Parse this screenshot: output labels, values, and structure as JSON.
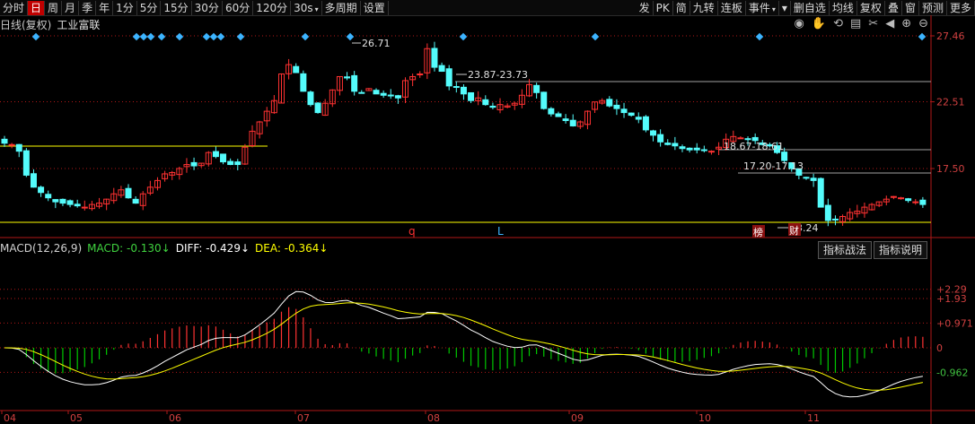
{
  "toolbar": {
    "left": [
      "分时",
      "日",
      "周",
      "月",
      "季",
      "年",
      "1分",
      "5分",
      "15分",
      "30分",
      "60分",
      "120分",
      "30s",
      "多周期",
      "设置"
    ],
    "active": "日",
    "right": [
      "发",
      "PK",
      "简",
      "九转",
      "连板",
      "事件",
      "▾",
      "删自选",
      "均线",
      "复权",
      "叠",
      "窗",
      "预测",
      "更多"
    ]
  },
  "header": {
    "name_prefix": "日线(复权)",
    "stock_name": "工业富联"
  },
  "header_icons": [
    "eye-icon",
    "hand-icon",
    "history-icon",
    "tools-icon",
    "scissors-icon",
    "arrow-left-icon",
    "plus-icon",
    "minus-icon"
  ],
  "colors": {
    "up": "#ff3232",
    "down": "#54fcfc",
    "dif": "#ffffff",
    "dea": "#ffff00",
    "axis": "#b01818",
    "hline": "#ffff00"
  },
  "price_axis": {
    "labels": [
      "27.46",
      "22.51",
      "17.50"
    ]
  },
  "macd": {
    "title": "MACD(12,26,9)",
    "macd_label": "MACD:",
    "macd_value": "-0.130",
    "diff_label": "DIFF:",
    "diff_value": "-0.429",
    "dea_label": "DEA:",
    "dea_value": "-0.364",
    "axis_labels": [
      "2.29",
      "1.93",
      "0.971",
      "0",
      "-0.962"
    ]
  },
  "buttons": {
    "strategy": "指标战法",
    "explain": "指标说明"
  },
  "x_axis": [
    "04",
    "05",
    "06",
    "07",
    "08",
    "09",
    "10",
    "11"
  ],
  "annotations": {
    "high": "26.71",
    "range1": "23.87-23.73",
    "range2": "18.67-18.61",
    "range3": "17.20-17.13",
    "low": "13.24",
    "mark_q": "q",
    "mark_l": "L",
    "badge_bang": "榜",
    "badge_cai": "财"
  },
  "chart_data": {
    "type": "candlestick",
    "period": "daily",
    "y_ticks": [
      27.46,
      22.51,
      17.5
    ],
    "candles_count": 126,
    "close_approx": [
      19.4,
      19.3,
      18.8,
      17.0,
      16.1,
      15.7,
      15.3,
      15.0,
      14.9,
      14.8,
      14.7,
      14.6,
      14.8,
      14.9,
      15.2,
      15.6,
      15.9,
      15.3,
      14.9,
      15.6,
      16.1,
      16.6,
      17.1,
      17.2,
      17.5,
      17.8,
      17.7,
      17.9,
      18.7,
      18.4,
      18.0,
      17.8,
      17.8,
      19.1,
      20.3,
      21.0,
      21.8,
      22.6,
      24.6,
      25.3,
      24.7,
      23.3,
      22.3,
      21.7,
      22.4,
      23.4,
      24.4,
      24.3,
      23.3,
      23.2,
      23.5,
      23.1,
      23.0,
      23.0,
      22.8,
      24.1,
      24.4,
      24.6,
      26.5,
      25.1,
      24.8,
      23.7,
      23.6,
      23.1,
      22.6,
      22.8,
      22.3,
      22.1,
      22.3,
      22.2,
      22.4,
      23.0,
      23.8,
      23.2,
      22.0,
      21.6,
      21.4,
      21.1,
      20.7,
      21.0,
      21.8,
      22.5,
      22.6,
      22.2,
      22.0,
      21.7,
      21.5,
      21.2,
      20.4,
      20.0,
      19.5,
      19.3,
      19.2,
      19.0,
      18.9,
      18.9,
      18.9,
      18.8,
      19.1,
      19.7,
      19.9,
      19.8,
      19.7,
      19.6,
      19.3,
      19.2,
      18.7,
      18.1,
      17.5,
      17.0,
      16.8,
      16.6,
      14.6,
      13.6,
      13.7,
      13.9,
      14.2,
      14.3,
      14.6,
      14.8,
      15.0,
      15.2,
      15.4,
      15.3,
      15.1,
      15.0,
      14.8
    ],
    "macd_y_ticks": [
      2.29,
      1.93,
      0.971,
      0,
      -0.962
    ],
    "macd_params": [
      12,
      26,
      9
    ],
    "last_macd": -0.13,
    "last_dif": -0.429,
    "last_dea": -0.364
  }
}
